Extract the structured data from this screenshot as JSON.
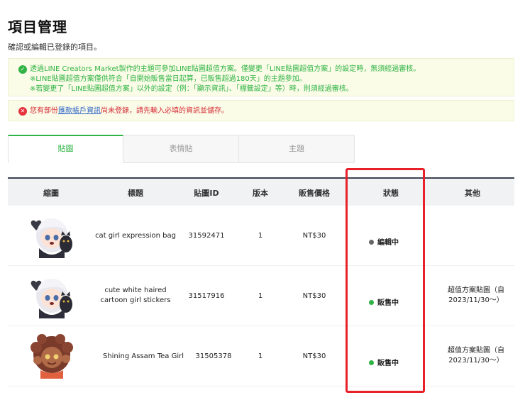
{
  "page": {
    "title": "項目管理",
    "subtitle": "確認或編輯已登錄的項目。"
  },
  "notices": {
    "success_lines": [
      "透過LINE Creators Market製作的主題可參加LINE貼圖超值方案。僅變更「LINE貼圖超值方案」的設定時，無須經過審核。",
      "※LINE貼圖超值方案僅供符合「自開始販售當日起算，已販售超過180天」的主題參加。",
      "※若變更了「LINE貼圖超值方案」以外的設定（例：「顯示資訊」、「標籤設定」等）時，則須經過審核。"
    ],
    "error_prefix": "您有部份",
    "error_link": "匯款帳戶資訊",
    "error_suffix": "尚未登錄，請先輸入必填的資訊並儲存。"
  },
  "tabs": [
    "貼圖",
    "表情貼",
    "主題"
  ],
  "table": {
    "headers": [
      "縮圖",
      "標題",
      "貼圖ID",
      "版本",
      "販售價格",
      "狀態",
      "其他"
    ],
    "rows": [
      {
        "title": "cat girl expression bag",
        "id": "31592471",
        "version": "1",
        "price": "NT$30",
        "status": "編輯中",
        "other": ""
      },
      {
        "title": "cute white haired cartoon girl stickers",
        "id": "31517916",
        "version": "1",
        "price": "NT$30",
        "status": "販售中",
        "other": "超值方案貼圖（自2023/11/30～）"
      },
      {
        "title": "Shining Assam Tea Girl",
        "id": "31505378",
        "version": "1",
        "price": "NT$30",
        "status": "販售中",
        "other": "超值方案貼圖（自2023/11/30～）"
      }
    ]
  },
  "colors": {
    "accent_green": "#2fb344",
    "error_red": "#d52b35",
    "link_blue": "#2b63c6",
    "status_editing": "#666666",
    "status_selling": "#2fb344",
    "highlight_red": "#e8202a"
  }
}
